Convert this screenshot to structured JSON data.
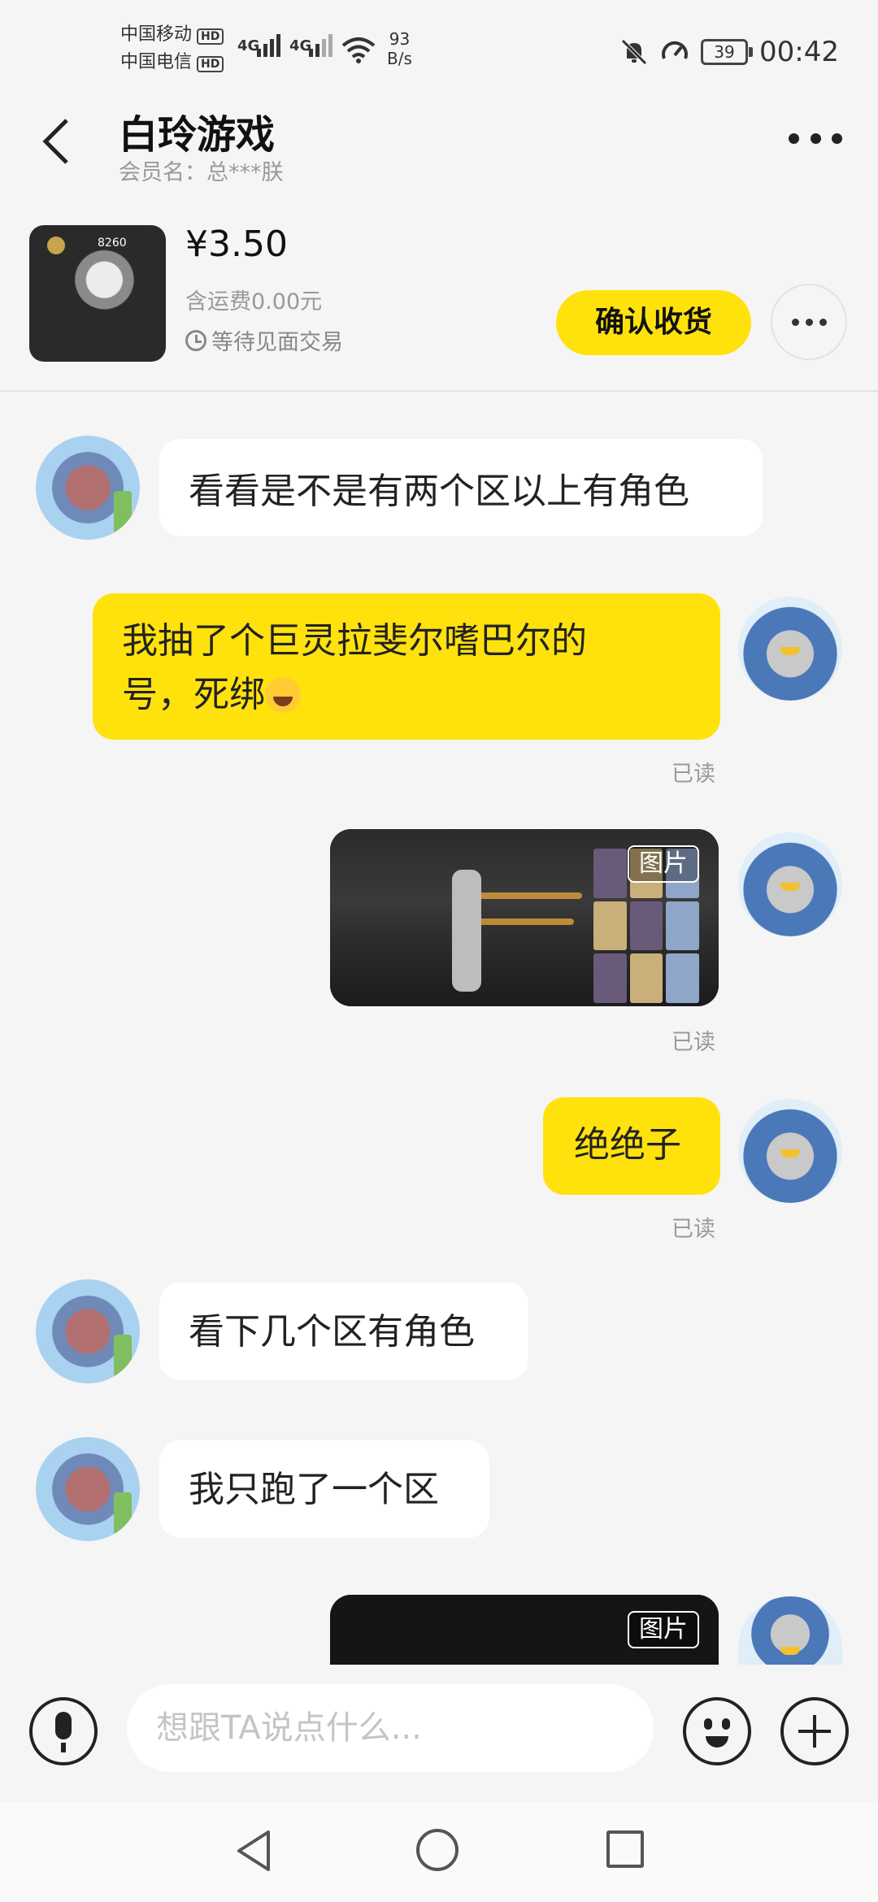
{
  "status_bar": {
    "carrier1": "中国移动",
    "carrier2": "中国电信",
    "hd": "HD",
    "net": "4G",
    "speed_value": "93",
    "speed_unit": "B/s",
    "battery": "39",
    "time": "00:42"
  },
  "header": {
    "title": "白玲游戏",
    "subtitle": "会员名：总***朕"
  },
  "product": {
    "thumb_number": "8260",
    "price": "¥3.50",
    "shipping": "含运费0.00元",
    "status": "等待见面交易",
    "confirm_label": "确认收货"
  },
  "messages": [
    {
      "from": "other",
      "text": "看看是不是有两个区以上有角色"
    },
    {
      "from": "self",
      "line1": "我抽了个巨灵拉斐尔嗜巴尔的",
      "line2": "号，死绑",
      "read": "已读"
    },
    {
      "from": "self",
      "type": "image",
      "tag": "图片",
      "read": "已读"
    },
    {
      "from": "self",
      "text": "绝绝子",
      "read": "已读"
    },
    {
      "from": "other",
      "text": "看下几个区有角色"
    },
    {
      "from": "other",
      "text": "我只跑了一个区"
    },
    {
      "from": "self",
      "type": "image",
      "tag": "图片"
    }
  ],
  "input": {
    "placeholder": "想跟TA说点什么..."
  },
  "icons": {
    "back": "back-arrow-icon",
    "more": "more-dots-icon",
    "mic": "microphone-icon",
    "emoji": "emoji-icon",
    "plus": "plus-icon"
  },
  "colors": {
    "accent": "#ffe20c",
    "background": "#f5f5f5"
  }
}
